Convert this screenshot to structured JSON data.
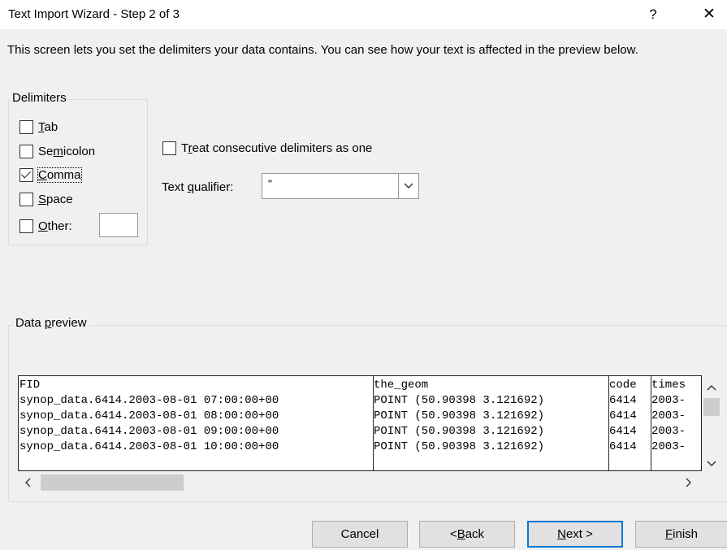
{
  "window": {
    "title": "Text Import Wizard - Step 2 of 3",
    "help_glyph": "?",
    "close_glyph": "✕"
  },
  "description": "This screen lets you set the delimiters your data contains.  You can see how your text is affected in the preview below.",
  "delimiters": {
    "group_label": "Delimiters",
    "options": [
      {
        "label": "Tab",
        "checked": false
      },
      {
        "label": "Semicolon",
        "checked": false
      },
      {
        "label": "Comma",
        "checked": true
      },
      {
        "label": "Space",
        "checked": false
      },
      {
        "label": "Other:",
        "checked": false
      }
    ],
    "other_value": ""
  },
  "consecutive": {
    "label": "Treat consecutive delimiters as one",
    "checked": false
  },
  "qualifier": {
    "label": "Text qualifier:",
    "value": "\""
  },
  "preview": {
    "group_label": "Data preview",
    "columns": [
      "FID",
      "the_geom",
      "code",
      "times"
    ],
    "rows": [
      [
        "synop_data.6414.2003-08-01 07:00:00+00",
        "POINT (50.90398 3.121692)",
        "6414",
        "2003-"
      ],
      [
        "synop_data.6414.2003-08-01 08:00:00+00",
        "POINT (50.90398 3.121692)",
        "6414",
        "2003-"
      ],
      [
        "synop_data.6414.2003-08-01 09:00:00+00",
        "POINT (50.90398 3.121692)",
        "6414",
        "2003-"
      ],
      [
        "synop_data.6414.2003-08-01 10:00:00+00",
        "POINT (50.90398 3.121692)",
        "6414",
        "2003-"
      ]
    ]
  },
  "buttons": {
    "cancel": "Cancel",
    "back": "< Back",
    "next": "Next >",
    "finish": "Finish"
  },
  "colors": {
    "accent": "#0078d7"
  }
}
